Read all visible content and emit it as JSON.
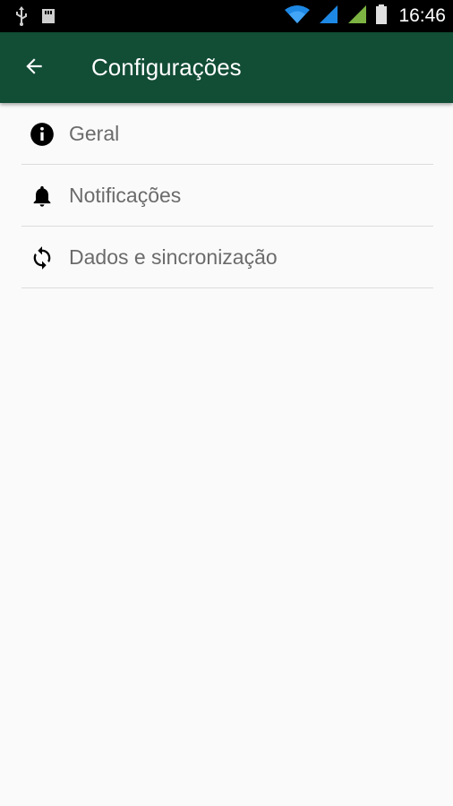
{
  "status_bar": {
    "time": "16:46",
    "icons": [
      "usb-icon",
      "storage-icon",
      "wifi-icon",
      "signal-icon",
      "signal-icon",
      "battery-icon"
    ]
  },
  "app_bar": {
    "title": "Configurações",
    "back_icon": "arrow-back-icon",
    "color": "#124d36"
  },
  "settings": {
    "items": [
      {
        "label": "Geral",
        "icon": "info-icon"
      },
      {
        "label": "Notificações",
        "icon": "bell-icon"
      },
      {
        "label": "Dados e sincronização",
        "icon": "sync-icon"
      }
    ]
  },
  "colors": {
    "background": "#fafafa",
    "divider": "#dcdcdc",
    "label": "#6b6b6b",
    "signal_blue": "#1e88e5",
    "signal_green": "#7cb342"
  }
}
